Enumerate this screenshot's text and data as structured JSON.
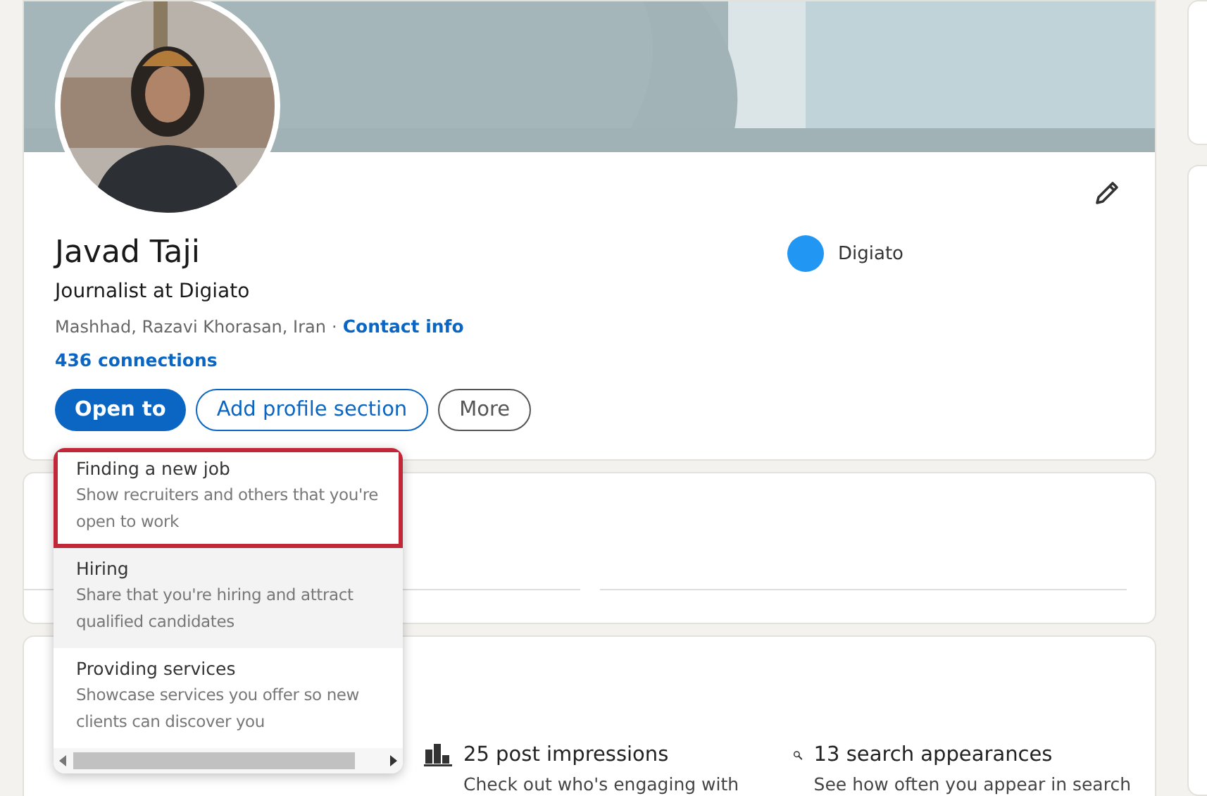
{
  "profile": {
    "name": "Javad Taji",
    "headline": "Journalist at Digiato",
    "location": "Mashhad, Razavi Khorasan, Iran",
    "separator": "·",
    "contact_link": "Contact info",
    "connections": "436 connections",
    "company": "Digiato"
  },
  "actions": [
    {
      "label": "Open to",
      "kind": "primary"
    },
    {
      "label": "Add profile section",
      "kind": "outline"
    },
    {
      "label": "More",
      "kind": "secondary"
    }
  ],
  "open_to_menu": [
    {
      "title": "Finding a new job",
      "description": "Show recruiters and others that you're open to work",
      "highlighted": true,
      "hovered": false
    },
    {
      "title": "Hiring",
      "description": "Share that you're hiring and attract qualified candidates",
      "highlighted": false,
      "hovered": true
    },
    {
      "title": "Providing services",
      "description": "Showcase services you offer so new clients can discover you",
      "highlighted": false,
      "hovered": false
    }
  ],
  "analytics": [
    {
      "kind": "impressions",
      "title": "25 post impressions",
      "subtitle": "Check out who's engaging with"
    },
    {
      "kind": "search",
      "title": "13 search appearances",
      "subtitle": "See how often you appear in search"
    }
  ]
}
